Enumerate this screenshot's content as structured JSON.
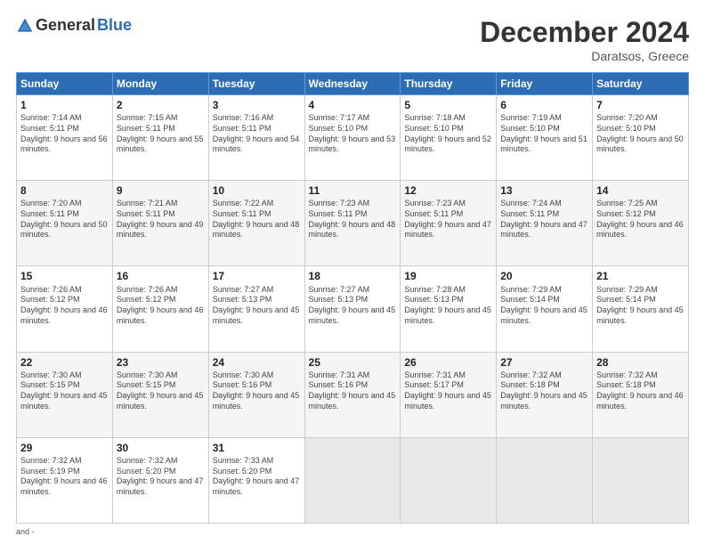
{
  "header": {
    "logo_general": "General",
    "logo_blue": "Blue",
    "month_title": "December 2024",
    "location": "Daratsos, Greece"
  },
  "days_of_week": [
    "Sunday",
    "Monday",
    "Tuesday",
    "Wednesday",
    "Thursday",
    "Friday",
    "Saturday"
  ],
  "weeks": [
    [
      {
        "day": "1",
        "sunrise": "Sunrise: 7:14 AM",
        "sunset": "Sunset: 5:11 PM",
        "daylight": "Daylight: 9 hours and 56 minutes."
      },
      {
        "day": "2",
        "sunrise": "Sunrise: 7:15 AM",
        "sunset": "Sunset: 5:11 PM",
        "daylight": "Daylight: 9 hours and 55 minutes."
      },
      {
        "day": "3",
        "sunrise": "Sunrise: 7:16 AM",
        "sunset": "Sunset: 5:11 PM",
        "daylight": "Daylight: 9 hours and 54 minutes."
      },
      {
        "day": "4",
        "sunrise": "Sunrise: 7:17 AM",
        "sunset": "Sunset: 5:10 PM",
        "daylight": "Daylight: 9 hours and 53 minutes."
      },
      {
        "day": "5",
        "sunrise": "Sunrise: 7:18 AM",
        "sunset": "Sunset: 5:10 PM",
        "daylight": "Daylight: 9 hours and 52 minutes."
      },
      {
        "day": "6",
        "sunrise": "Sunrise: 7:19 AM",
        "sunset": "Sunset: 5:10 PM",
        "daylight": "Daylight: 9 hours and 51 minutes."
      },
      {
        "day": "7",
        "sunrise": "Sunrise: 7:20 AM",
        "sunset": "Sunset: 5:10 PM",
        "daylight": "Daylight: 9 hours and 50 minutes."
      }
    ],
    [
      {
        "day": "8",
        "sunrise": "Sunrise: 7:20 AM",
        "sunset": "Sunset: 5:11 PM",
        "daylight": "Daylight: 9 hours and 50 minutes."
      },
      {
        "day": "9",
        "sunrise": "Sunrise: 7:21 AM",
        "sunset": "Sunset: 5:11 PM",
        "daylight": "Daylight: 9 hours and 49 minutes."
      },
      {
        "day": "10",
        "sunrise": "Sunrise: 7:22 AM",
        "sunset": "Sunset: 5:11 PM",
        "daylight": "Daylight: 9 hours and 48 minutes."
      },
      {
        "day": "11",
        "sunrise": "Sunrise: 7:23 AM",
        "sunset": "Sunset: 5:11 PM",
        "daylight": "Daylight: 9 hours and 48 minutes."
      },
      {
        "day": "12",
        "sunrise": "Sunrise: 7:23 AM",
        "sunset": "Sunset: 5:11 PM",
        "daylight": "Daylight: 9 hours and 47 minutes."
      },
      {
        "day": "13",
        "sunrise": "Sunrise: 7:24 AM",
        "sunset": "Sunset: 5:11 PM",
        "daylight": "Daylight: 9 hours and 47 minutes."
      },
      {
        "day": "14",
        "sunrise": "Sunrise: 7:25 AM",
        "sunset": "Sunset: 5:12 PM",
        "daylight": "Daylight: 9 hours and 46 minutes."
      }
    ],
    [
      {
        "day": "15",
        "sunrise": "Sunrise: 7:26 AM",
        "sunset": "Sunset: 5:12 PM",
        "daylight": "Daylight: 9 hours and 46 minutes."
      },
      {
        "day": "16",
        "sunrise": "Sunrise: 7:26 AM",
        "sunset": "Sunset: 5:12 PM",
        "daylight": "Daylight: 9 hours and 46 minutes."
      },
      {
        "day": "17",
        "sunrise": "Sunrise: 7:27 AM",
        "sunset": "Sunset: 5:13 PM",
        "daylight": "Daylight: 9 hours and 45 minutes."
      },
      {
        "day": "18",
        "sunrise": "Sunrise: 7:27 AM",
        "sunset": "Sunset: 5:13 PM",
        "daylight": "Daylight: 9 hours and 45 minutes."
      },
      {
        "day": "19",
        "sunrise": "Sunrise: 7:28 AM",
        "sunset": "Sunset: 5:13 PM",
        "daylight": "Daylight: 9 hours and 45 minutes."
      },
      {
        "day": "20",
        "sunrise": "Sunrise: 7:29 AM",
        "sunset": "Sunset: 5:14 PM",
        "daylight": "Daylight: 9 hours and 45 minutes."
      },
      {
        "day": "21",
        "sunrise": "Sunrise: 7:29 AM",
        "sunset": "Sunset: 5:14 PM",
        "daylight": "Daylight: 9 hours and 45 minutes."
      }
    ],
    [
      {
        "day": "22",
        "sunrise": "Sunrise: 7:30 AM",
        "sunset": "Sunset: 5:15 PM",
        "daylight": "Daylight: 9 hours and 45 minutes."
      },
      {
        "day": "23",
        "sunrise": "Sunrise: 7:30 AM",
        "sunset": "Sunset: 5:15 PM",
        "daylight": "Daylight: 9 hours and 45 minutes."
      },
      {
        "day": "24",
        "sunrise": "Sunrise: 7:30 AM",
        "sunset": "Sunset: 5:16 PM",
        "daylight": "Daylight: 9 hours and 45 minutes."
      },
      {
        "day": "25",
        "sunrise": "Sunrise: 7:31 AM",
        "sunset": "Sunset: 5:16 PM",
        "daylight": "Daylight: 9 hours and 45 minutes."
      },
      {
        "day": "26",
        "sunrise": "Sunrise: 7:31 AM",
        "sunset": "Sunset: 5:17 PM",
        "daylight": "Daylight: 9 hours and 45 minutes."
      },
      {
        "day": "27",
        "sunrise": "Sunrise: 7:32 AM",
        "sunset": "Sunset: 5:18 PM",
        "daylight": "Daylight: 9 hours and 45 minutes."
      },
      {
        "day": "28",
        "sunrise": "Sunrise: 7:32 AM",
        "sunset": "Sunset: 5:18 PM",
        "daylight": "Daylight: 9 hours and 46 minutes."
      }
    ],
    [
      {
        "day": "29",
        "sunrise": "Sunrise: 7:32 AM",
        "sunset": "Sunset: 5:19 PM",
        "daylight": "Daylight: 9 hours and 46 minutes."
      },
      {
        "day": "30",
        "sunrise": "Sunrise: 7:32 AM",
        "sunset": "Sunset: 5:20 PM",
        "daylight": "Daylight: 9 hours and 47 minutes."
      },
      {
        "day": "31",
        "sunrise": "Sunrise: 7:33 AM",
        "sunset": "Sunset: 5:20 PM",
        "daylight": "Daylight: 9 hours and 47 minutes."
      },
      null,
      null,
      null,
      null
    ]
  ],
  "footer": "and -"
}
